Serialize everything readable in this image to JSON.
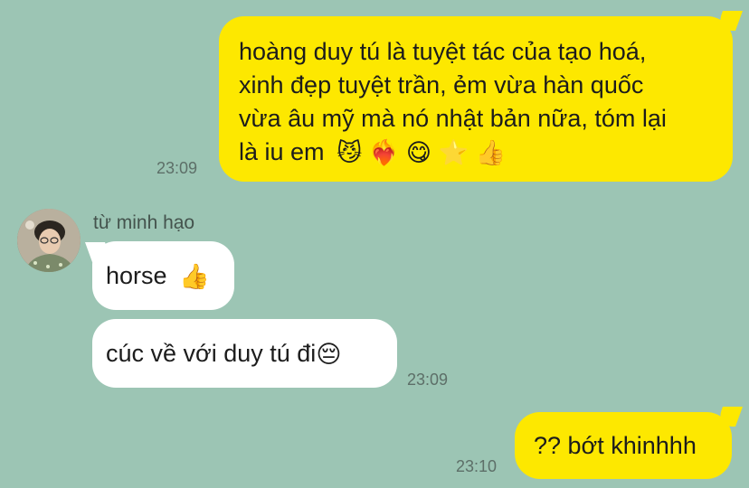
{
  "messages": [
    {
      "side": "right",
      "lines": [
        "hoàng duy tú là tuyệt tác của tạo hoá,",
        "xinh đẹp tuyệt trần, ẻm vừa hàn quốc",
        "vừa âu mỹ mà nó nhật bản nữa, tóm lại",
        "là iu em"
      ],
      "emojis": [
        "😼",
        "❤️‍🔥",
        "😋",
        "⭐",
        "👍"
      ],
      "time": "23:09"
    },
    {
      "side": "left",
      "sender": "từ minh hạo",
      "text": "horse",
      "emoji": "👍"
    },
    {
      "side": "left",
      "text": "cúc về với duy tú đi",
      "emoji": "😔",
      "time": "23:09"
    },
    {
      "side": "right",
      "text": "?? bớt khinhhh",
      "time": "23:10"
    }
  ]
}
